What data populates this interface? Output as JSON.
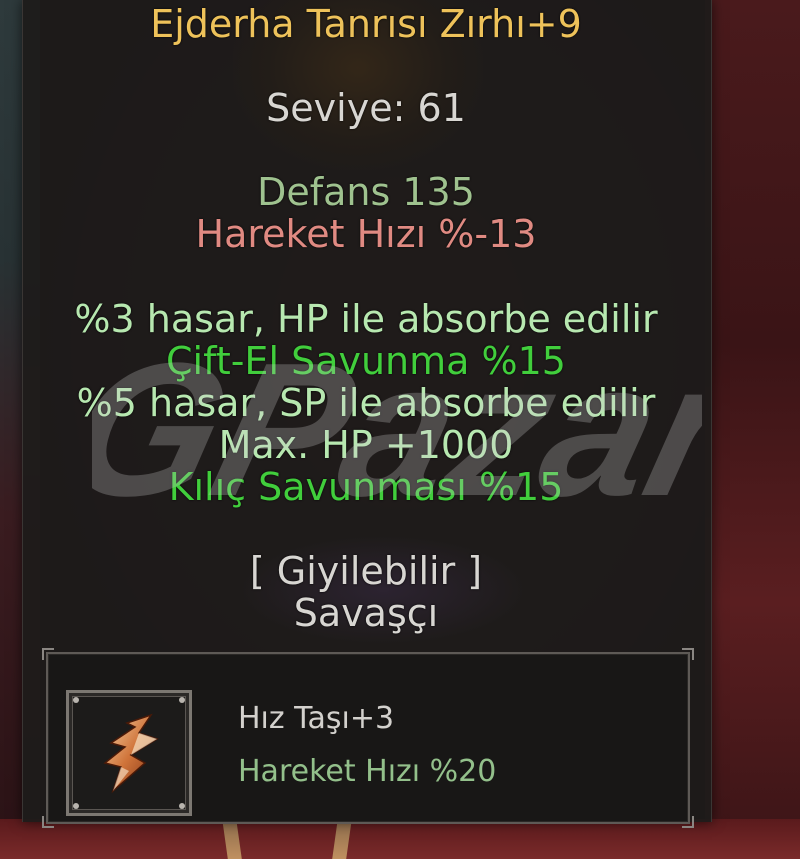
{
  "item": {
    "name": "Ejderha Tanrısı Zırhı+9",
    "level": "Seviye: 61",
    "defense": "Defans 135",
    "move_speed": "Hareket Hızı %-13",
    "bonuses": [
      "%3 hasar, HP ile absorbe edilir",
      "Çift-El Savunma %15",
      "%5 hasar, SP ile absorbe edilir",
      "Max. HP +1000",
      "Kılıç Savunması %15"
    ],
    "wearable": "[ Giyilebilir ]",
    "class": "Savaşçı"
  },
  "socket": {
    "stone_name": "Hız Taşı+3",
    "stone_stat": "Hareket Hızı %20",
    "icon": "speed-stone-icon"
  },
  "watermark": "GPazar",
  "colors": {
    "name": "#eec25a",
    "white": "#d8d6d2",
    "defense": "#9fc28f",
    "penalty": "#e08a82",
    "bonus_pale": "#b7e8b0",
    "bonus_bright": "#41ce3c"
  }
}
